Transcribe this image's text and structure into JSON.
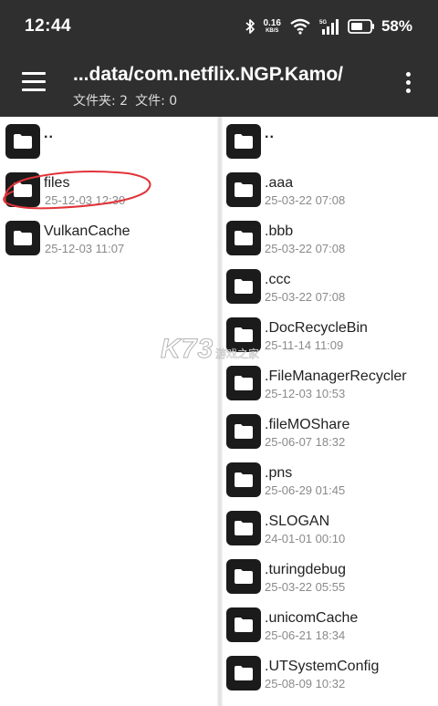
{
  "status_bar": {
    "time": "12:44",
    "net_speed_value": "0.16",
    "net_speed_unit": "KB/S",
    "battery_percent": "58%"
  },
  "app_bar": {
    "path_title": "...data/com.netflix.NGP.Kamo/",
    "folder_count_label": "文件夹: 2",
    "file_count_label": "文件: 0",
    "icons": {
      "menu": "hamburger-menu-icon",
      "more": "more-vertical-icon"
    }
  },
  "left_pane": {
    "parent_label": "..",
    "items": [
      {
        "name": "files",
        "date": "25-12-03 12:30"
      },
      {
        "name": "VulkanCache",
        "date": "25-12-03 11:07"
      }
    ]
  },
  "right_pane": {
    "parent_label": "..",
    "items": [
      {
        "name": ".aaa",
        "date": "25-03-22 07:08"
      },
      {
        "name": ".bbb",
        "date": "25-03-22 07:08"
      },
      {
        "name": ".ccc",
        "date": "25-03-22 07:08"
      },
      {
        "name": ".DocRecycleBin",
        "date": "25-11-14 11:09"
      },
      {
        "name": ".FileManagerRecycler",
        "date": "25-12-03 10:53"
      },
      {
        "name": ".fileMOShare",
        "date": "25-06-07 18:32"
      },
      {
        "name": ".pns",
        "date": "25-06-29 01:45"
      },
      {
        "name": ".SLOGAN",
        "date": "24-01-01 00:10"
      },
      {
        "name": ".turingdebug",
        "date": "25-03-22 05:55"
      },
      {
        "name": ".unicomCache",
        "date": "25-06-21 18:34"
      },
      {
        "name": ".UTSystemConfig",
        "date": "25-08-09 10:32"
      }
    ]
  },
  "watermark": {
    "logo": "K73",
    "sub": "游戏之家"
  },
  "colors": {
    "bar_bg": "#2f2f2f",
    "icon_bg": "#1b1b1b",
    "annotation": "#e0343a",
    "date_text": "#8a8a8a"
  }
}
